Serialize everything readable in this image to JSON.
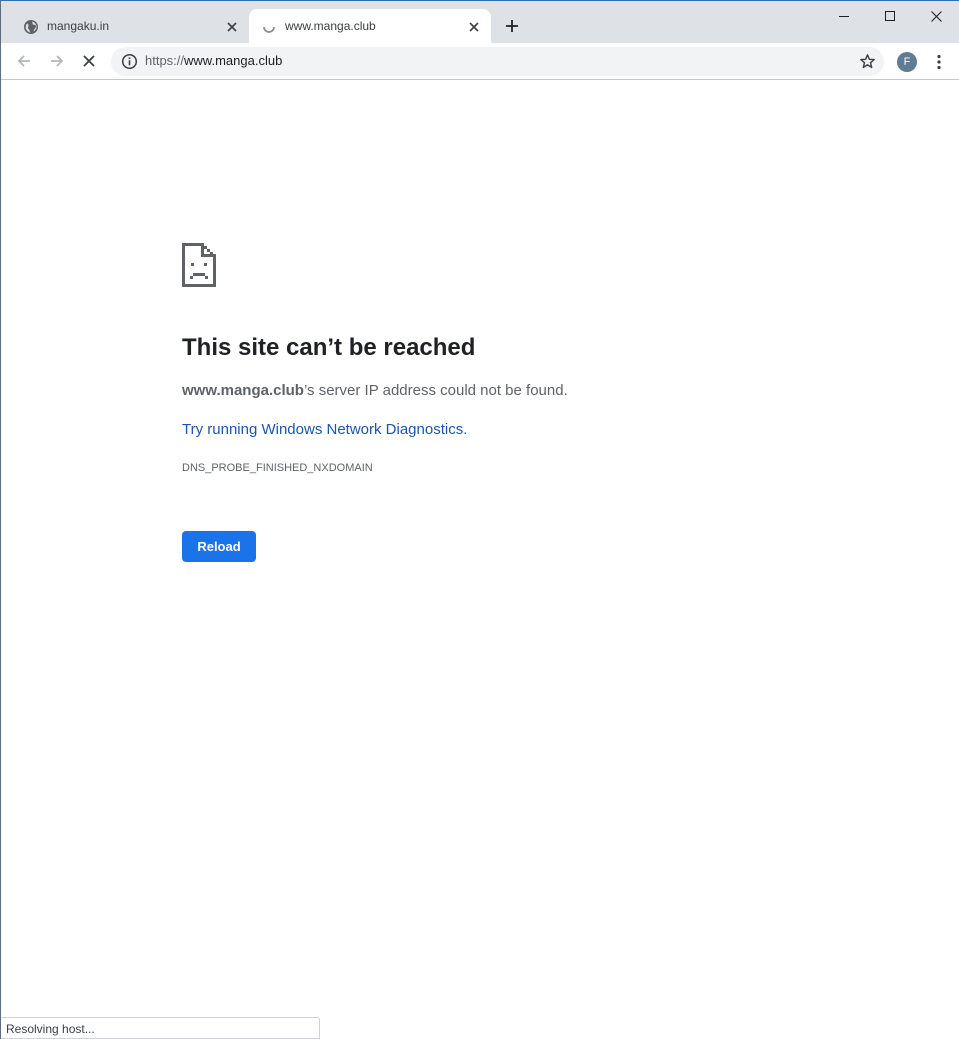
{
  "tabs": [
    {
      "title": "mangaku.in",
      "favicon": "globe-icon",
      "active": false
    },
    {
      "title": "www.manga.club",
      "favicon": "loading-spinner-icon",
      "active": true
    }
  ],
  "toolbar": {
    "url_scheme": "https://",
    "url_host": "www.manga.club"
  },
  "profile": {
    "initial": "F",
    "color": "#5f7c94"
  },
  "error": {
    "heading": "This site can’t be reached",
    "summary_host": "www.manga.club",
    "summary_rest": "’s server IP address could not be found.",
    "suggestion": "Try running Windows Network Diagnostics.",
    "code": "DNS_PROBE_FINISHED_NXDOMAIN",
    "reload_label": "Reload"
  },
  "status": {
    "text": "Resolving host..."
  },
  "colors": {
    "accent": "#1a73e8",
    "link": "#1a55b0",
    "tabstrip": "#dee1e6"
  }
}
